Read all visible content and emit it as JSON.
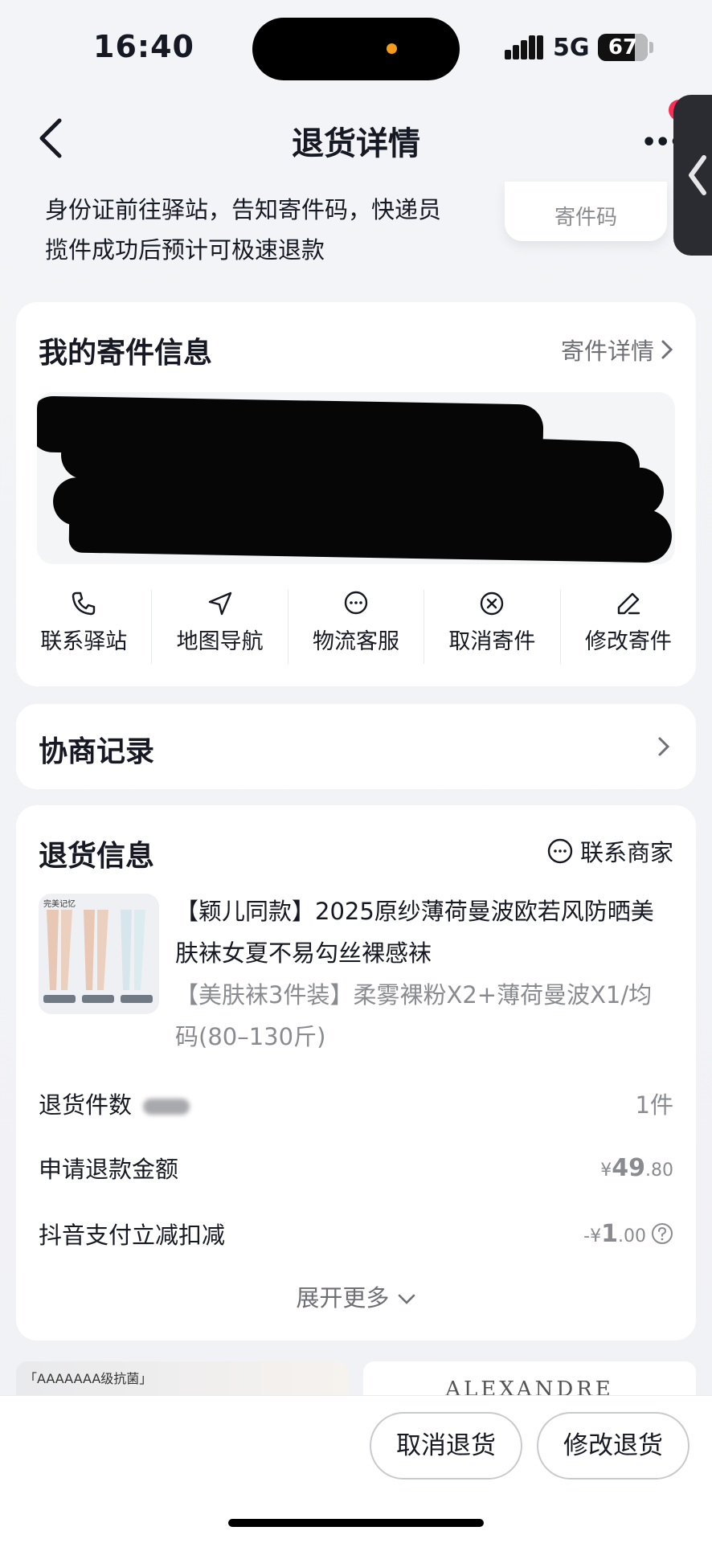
{
  "status_bar": {
    "time": "16:40",
    "network": "5G",
    "battery": "67"
  },
  "nav": {
    "title": "退货详情"
  },
  "pickup_notice": {
    "line1": "身份证前往驿站，告知寄件码，快递员",
    "line2": "揽件成功后预计可极速退款",
    "code_label": "寄件码"
  },
  "shipping_card": {
    "title": "我的寄件信息",
    "detail_link": "寄件详情",
    "actions": [
      {
        "label": "联系驿站",
        "icon": "phone-icon"
      },
      {
        "label": "地图导航",
        "icon": "navigation-icon"
      },
      {
        "label": "物流客服",
        "icon": "chat-icon"
      },
      {
        "label": "取消寄件",
        "icon": "cancel-circle-icon"
      },
      {
        "label": "修改寄件",
        "icon": "edit-icon"
      }
    ]
  },
  "negotiation": {
    "title": "协商记录"
  },
  "return_info": {
    "title": "退货信息",
    "contact": "联系商家",
    "product_image_brand": "完美记忆",
    "product_title": "【颖儿同款】2025原纱薄荷曼波欧若风防晒美肤袜女夏不易勾丝裸感袜",
    "product_sku": "【美肤袜3件装】柔雾裸粉X2+薄荷曼波X1/均码(80–130斤)",
    "rows": [
      {
        "label": "退货件数",
        "value": "1件"
      },
      {
        "label": "申请退款金额",
        "yen": "¥",
        "int": "49",
        "dec": ".80"
      },
      {
        "label": "抖音支付立减扣减",
        "prefix": "-",
        "yen": "¥",
        "int": "1",
        "dec": ".00"
      }
    ],
    "expand": "展开更多"
  },
  "ads": {
    "left_text": "「AAAAAAA级抗菌」",
    "right_text": "ALEXANDRE"
  },
  "bottom": {
    "cancel": "取消退货",
    "modify": "修改退货"
  },
  "colors": {
    "accent_red": "#fe2c55",
    "text_primary": "#161823",
    "text_secondary": "#8a8b91"
  }
}
